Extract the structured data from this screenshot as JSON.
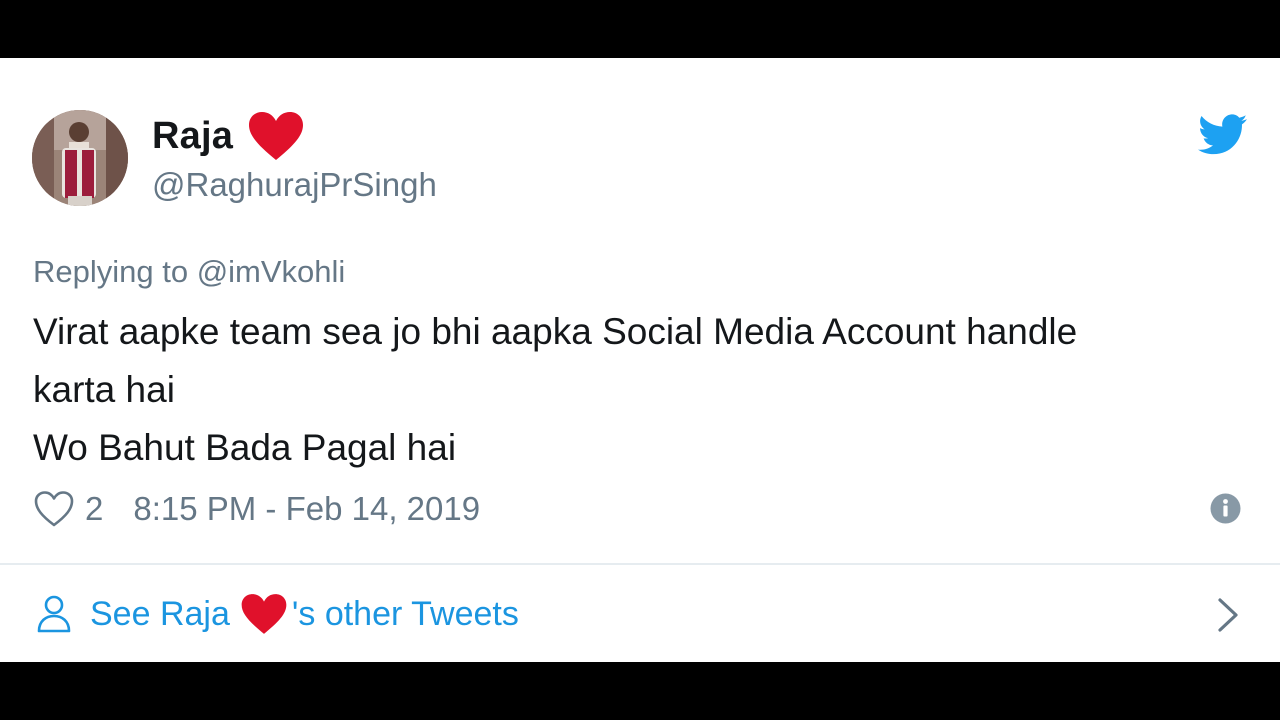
{
  "tweet": {
    "display_name": "Raja",
    "handle": "@RaghurajPrSingh",
    "replying_to": "Replying to @imVkohli",
    "text_lines": [
      "Virat aapke team sea jo bhi aapka Social Media Account handle",
      "karta hai",
      "Wo Bahut Bada Pagal hai"
    ],
    "like_count": "2",
    "timestamp": "8:15 PM - Feb 14, 2019"
  },
  "footer": {
    "link_prefix": "See Raja",
    "link_suffix": "'s other Tweets"
  },
  "icons": {
    "heart": "heart-emoji",
    "twitter": "twitter-bird-icon",
    "like": "heart-outline-icon",
    "info": "info-icon",
    "person": "person-icon",
    "chevron": "chevron-right-icon"
  },
  "colors": {
    "text_primary": "#14171a",
    "text_secondary": "#657786",
    "link": "#1b95e0",
    "twitter_blue": "#1da1f2",
    "heart_red": "#e0112b"
  }
}
